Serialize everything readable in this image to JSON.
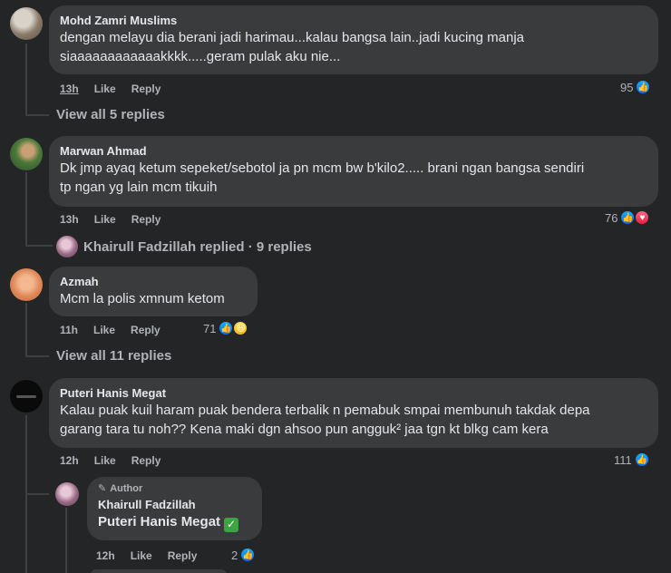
{
  "comments": [
    {
      "name": "Mohd Zamri Muslims",
      "lines": [
        "dengan melayu dia berani jadi harimau...kalau bangsa lain..jadi kucing manja",
        "siaaaaaaaaaaaakkkk.....geram pulak aku nie..."
      ],
      "time": "13h",
      "like": "Like",
      "reply": "Reply",
      "reaction_count": "95",
      "reactions": [
        "like"
      ],
      "replies_text": "View all 5 replies"
    },
    {
      "name": "Marwan Ahmad",
      "lines": [
        "Dk jmp ayaq ketum sepeket/sebotol ja pn mcm bw b'kilo2..... brani ngan bangsa sendiri",
        "tp ngan yg lain mcm tikuih"
      ],
      "time": "13h",
      "like": "Like",
      "reply": "Reply",
      "reaction_count": "76",
      "reactions": [
        "like",
        "love"
      ],
      "replies_text": "Khairull Fadzillah replied · 9 replies"
    },
    {
      "name": "Azmah",
      "lines": [
        "Mcm la polis xmnum ketom"
      ],
      "time": "11h",
      "like": "Like",
      "reply": "Reply",
      "reaction_count": "71",
      "reactions": [
        "like",
        "haha"
      ],
      "replies_text": "View all 11 replies"
    },
    {
      "name": "Puteri Hanis Megat",
      "lines": [
        "Kalau puak kuil haram puak bendera terbalik n pemabuk smpai membunuh takdak depa",
        "garang tara tu noh?? Kena maki dgn ahsoo pun angguk² jaa tgn kt blkg cam kera"
      ],
      "time": "12h",
      "like": "Like",
      "reply": "Reply",
      "reaction_count": "111",
      "reactions": [
        "like"
      ]
    }
  ],
  "reply": {
    "author_tag": "Author",
    "name": "Khairull Fadzillah",
    "mention": "Puteri Hanis Megat",
    "emoji": "✅",
    "time": "12h",
    "like": "Like",
    "reply": "Reply",
    "reaction_count": "2",
    "reactions": [
      "like"
    ]
  },
  "colors": {
    "background": "#242526",
    "bubble": "#3a3b3c",
    "like": "#0866ff",
    "love": "#e61e42"
  }
}
